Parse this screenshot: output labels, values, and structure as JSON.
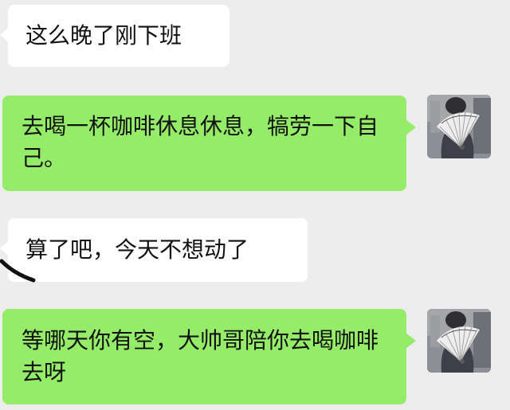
{
  "messages": [
    {
      "side": "incoming",
      "text": "这么晚了刚下班"
    },
    {
      "side": "outgoing",
      "text": "去喝一杯咖啡休息休息，犒劳一下自己。"
    },
    {
      "side": "incoming",
      "text": "算了吧，今天不想动了"
    },
    {
      "side": "outgoing",
      "text": "等哪天你有空，大帅哥陪你去喝咖啡去呀"
    }
  ],
  "avatar": {
    "icon": "user-avatar-fan-icon"
  },
  "colors": {
    "background": "#ededed",
    "incoming_bubble": "#ffffff",
    "outgoing_bubble": "#95ec69",
    "text": "#111111"
  }
}
